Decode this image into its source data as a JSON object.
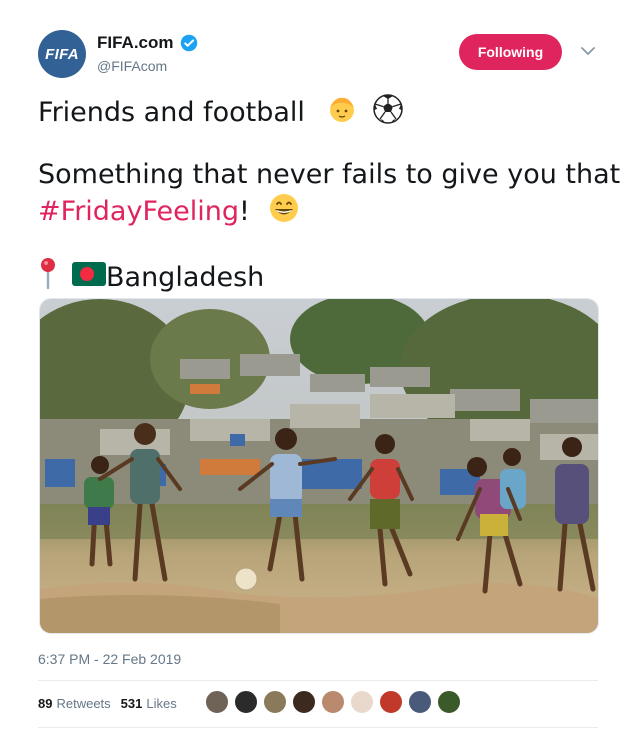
{
  "author": {
    "avatar_text": "FIFA",
    "display_name": "FIFA.com",
    "handle": "@FIFAcom",
    "verified": true
  },
  "follow_button": {
    "label": "Following"
  },
  "tweet": {
    "line1": "Friends and football",
    "line2": "Something that never fails to give you that",
    "hashtag": "#FridayFeeling",
    "hashtag_suffix": "!",
    "location": "Bangladesh",
    "emojis": [
      "child-face-icon",
      "soccer-ball-icon",
      "grinning-face-icon",
      "round-pushpin-icon",
      "bangladesh-flag-icon"
    ]
  },
  "media": {
    "description_icon": "photo-icon"
  },
  "timestamp": "6:37 PM - 22 Feb 2019",
  "stats": {
    "retweets_count": "89",
    "retweets_label": "Retweets",
    "likes_count": "531",
    "likes_label": "Likes"
  },
  "colors": {
    "accent": "#e0245e",
    "brand": "#326295",
    "verified": "#1da1f2",
    "muted": "#657786"
  }
}
